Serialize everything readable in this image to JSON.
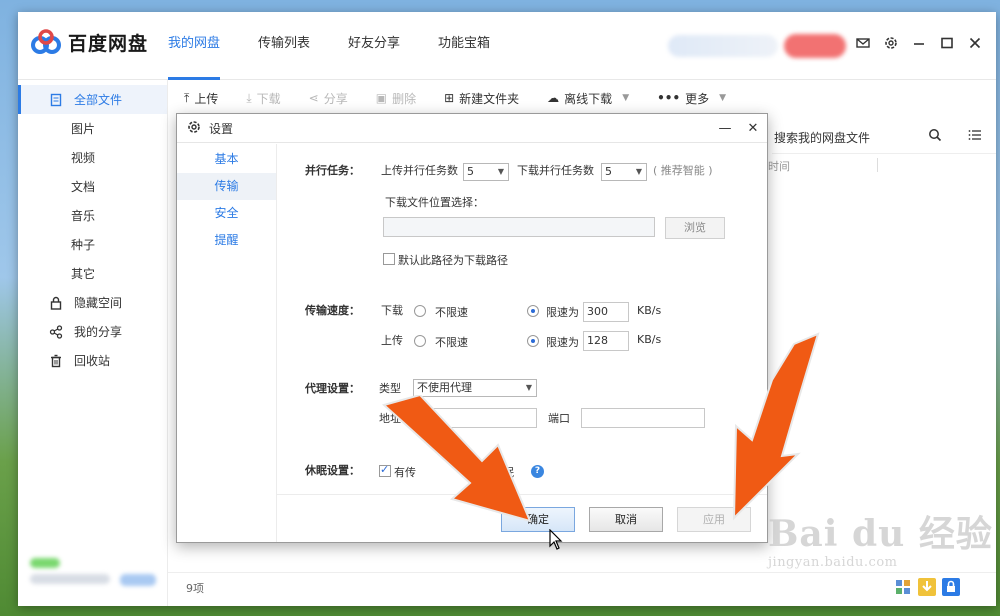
{
  "app": {
    "brand": "百度网盘",
    "nav": [
      "我的网盘",
      "传输列表",
      "好友分享",
      "功能宝箱"
    ],
    "active_nav": 0
  },
  "sidebar": {
    "items": [
      {
        "label": "全部文件",
        "icon": "file-icon",
        "active": true
      },
      {
        "label": "图片",
        "sub": true
      },
      {
        "label": "视频",
        "sub": true
      },
      {
        "label": "文档",
        "sub": true
      },
      {
        "label": "音乐",
        "sub": true
      },
      {
        "label": "种子",
        "sub": true
      },
      {
        "label": "其它",
        "sub": true
      },
      {
        "label": "隐藏空间",
        "icon": "lock-icon"
      },
      {
        "label": "我的分享",
        "icon": "share-icon"
      },
      {
        "label": "回收站",
        "icon": "trash-icon"
      }
    ]
  },
  "toolbar": {
    "upload": "上传",
    "download": "下载",
    "share": "分享",
    "delete": "删除",
    "new_folder": "新建文件夹",
    "offline_download": "离线下载",
    "more": "更多"
  },
  "file_panel": {
    "search_placeholder": "搜索我的网盘文件",
    "column_time": "时间",
    "item_count": "9项"
  },
  "dialog": {
    "title": "设置",
    "tabs": [
      "基本",
      "传输",
      "安全",
      "提醒"
    ],
    "active_tab": 1,
    "parallel": {
      "label": "并行任务：",
      "upload_label": "上传并行任务数",
      "upload_value": "5",
      "download_label": "下载并行任务数",
      "download_value": "5",
      "hint": "( 推荐智能 )"
    },
    "download_location": {
      "label": "下载文件位置选择：",
      "browse": "浏览",
      "default_checkbox": "默认此路径为下载路径",
      "default_checked": false
    },
    "speed": {
      "label": "传输速度：",
      "download_label": "下载",
      "upload_label": "上传",
      "unlimited": "不限速",
      "limit_to": "限速为",
      "download_limit": "300",
      "upload_limit": "128",
      "unit": "KB/s"
    },
    "proxy": {
      "label": "代理设置：",
      "type_label": "类型",
      "type_value": "不使用代理",
      "address_label": "地址",
      "port_label": "端口"
    },
    "sleep": {
      "label": "休眠设置：",
      "checkbox_text_left": "有传",
      "checkbox_text_right": "眠",
      "checked": true
    },
    "buttons": {
      "ok": "确定",
      "cancel": "取消",
      "apply": "应用"
    }
  },
  "watermark": {
    "text": "Bai du 经验",
    "url": "jingyan.baidu.com"
  },
  "colors": {
    "accent": "#2c7be5",
    "arrow": "#f05a14"
  }
}
